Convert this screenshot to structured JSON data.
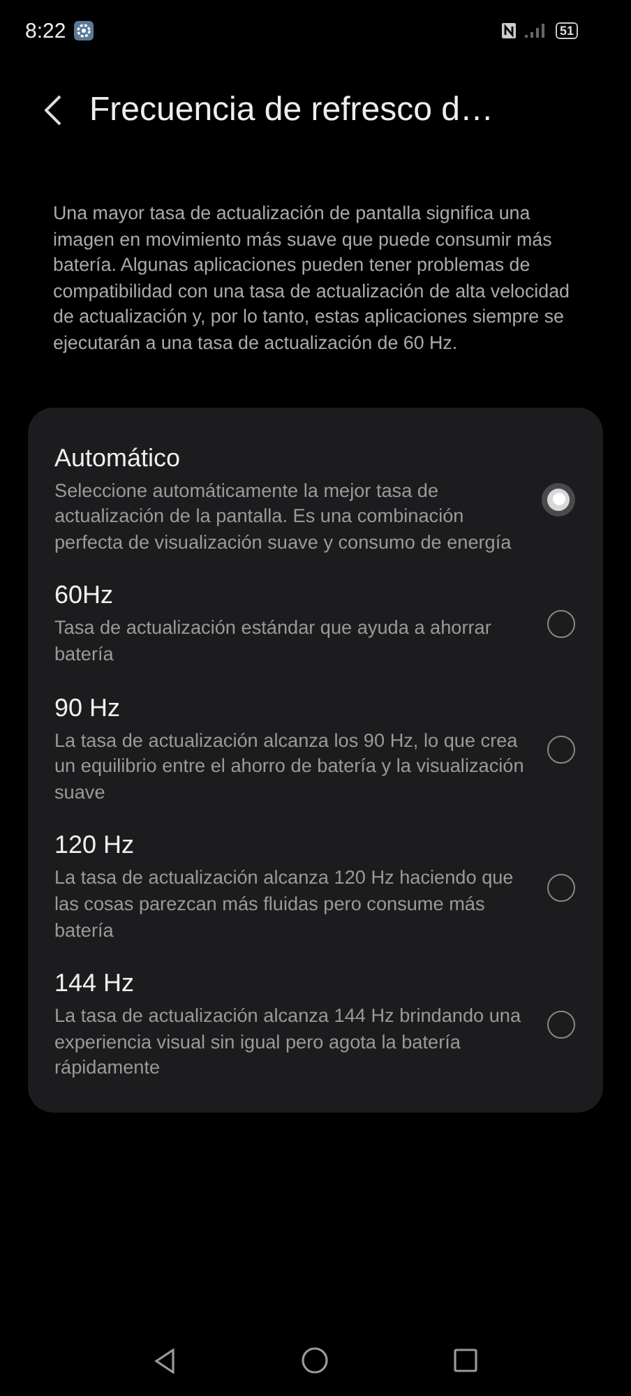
{
  "status_bar": {
    "time": "8:22",
    "battery": "51"
  },
  "header": {
    "title": "Frecuencia de refresco d…"
  },
  "description": "Una mayor tasa de actualización de pantalla significa una imagen en movimiento más suave que puede consumir más batería. Algunas aplicaciones pueden tener problemas de compatibilidad con una tasa de actualización de alta velocidad de actualización y, por lo tanto, estas aplicaciones siempre se ejecutarán a una tasa de actualización de 60 Hz.",
  "options": [
    {
      "title": "Automático",
      "description": "Seleccione automáticamente la mejor tasa de actualización de la pantalla. Es una combinación perfecta de visualización suave y consumo de energía",
      "selected": true
    },
    {
      "title": "60Hz",
      "description": "Tasa de actualización estándar que ayuda a ahorrar batería",
      "selected": false
    },
    {
      "title": "90 Hz",
      "description": "La tasa de actualización alcanza los 90 Hz, lo que crea un equilibrio entre el ahorro de batería y la visualización suave",
      "selected": false
    },
    {
      "title": "120 Hz",
      "description": "La tasa de actualización alcanza 120 Hz haciendo que las cosas parezcan más fluidas pero consume más batería",
      "selected": false
    },
    {
      "title": "144 Hz",
      "description": "La tasa de actualización alcanza 144 Hz brindando una experiencia visual sin igual pero agota la batería rápidamente",
      "selected": false
    }
  ]
}
